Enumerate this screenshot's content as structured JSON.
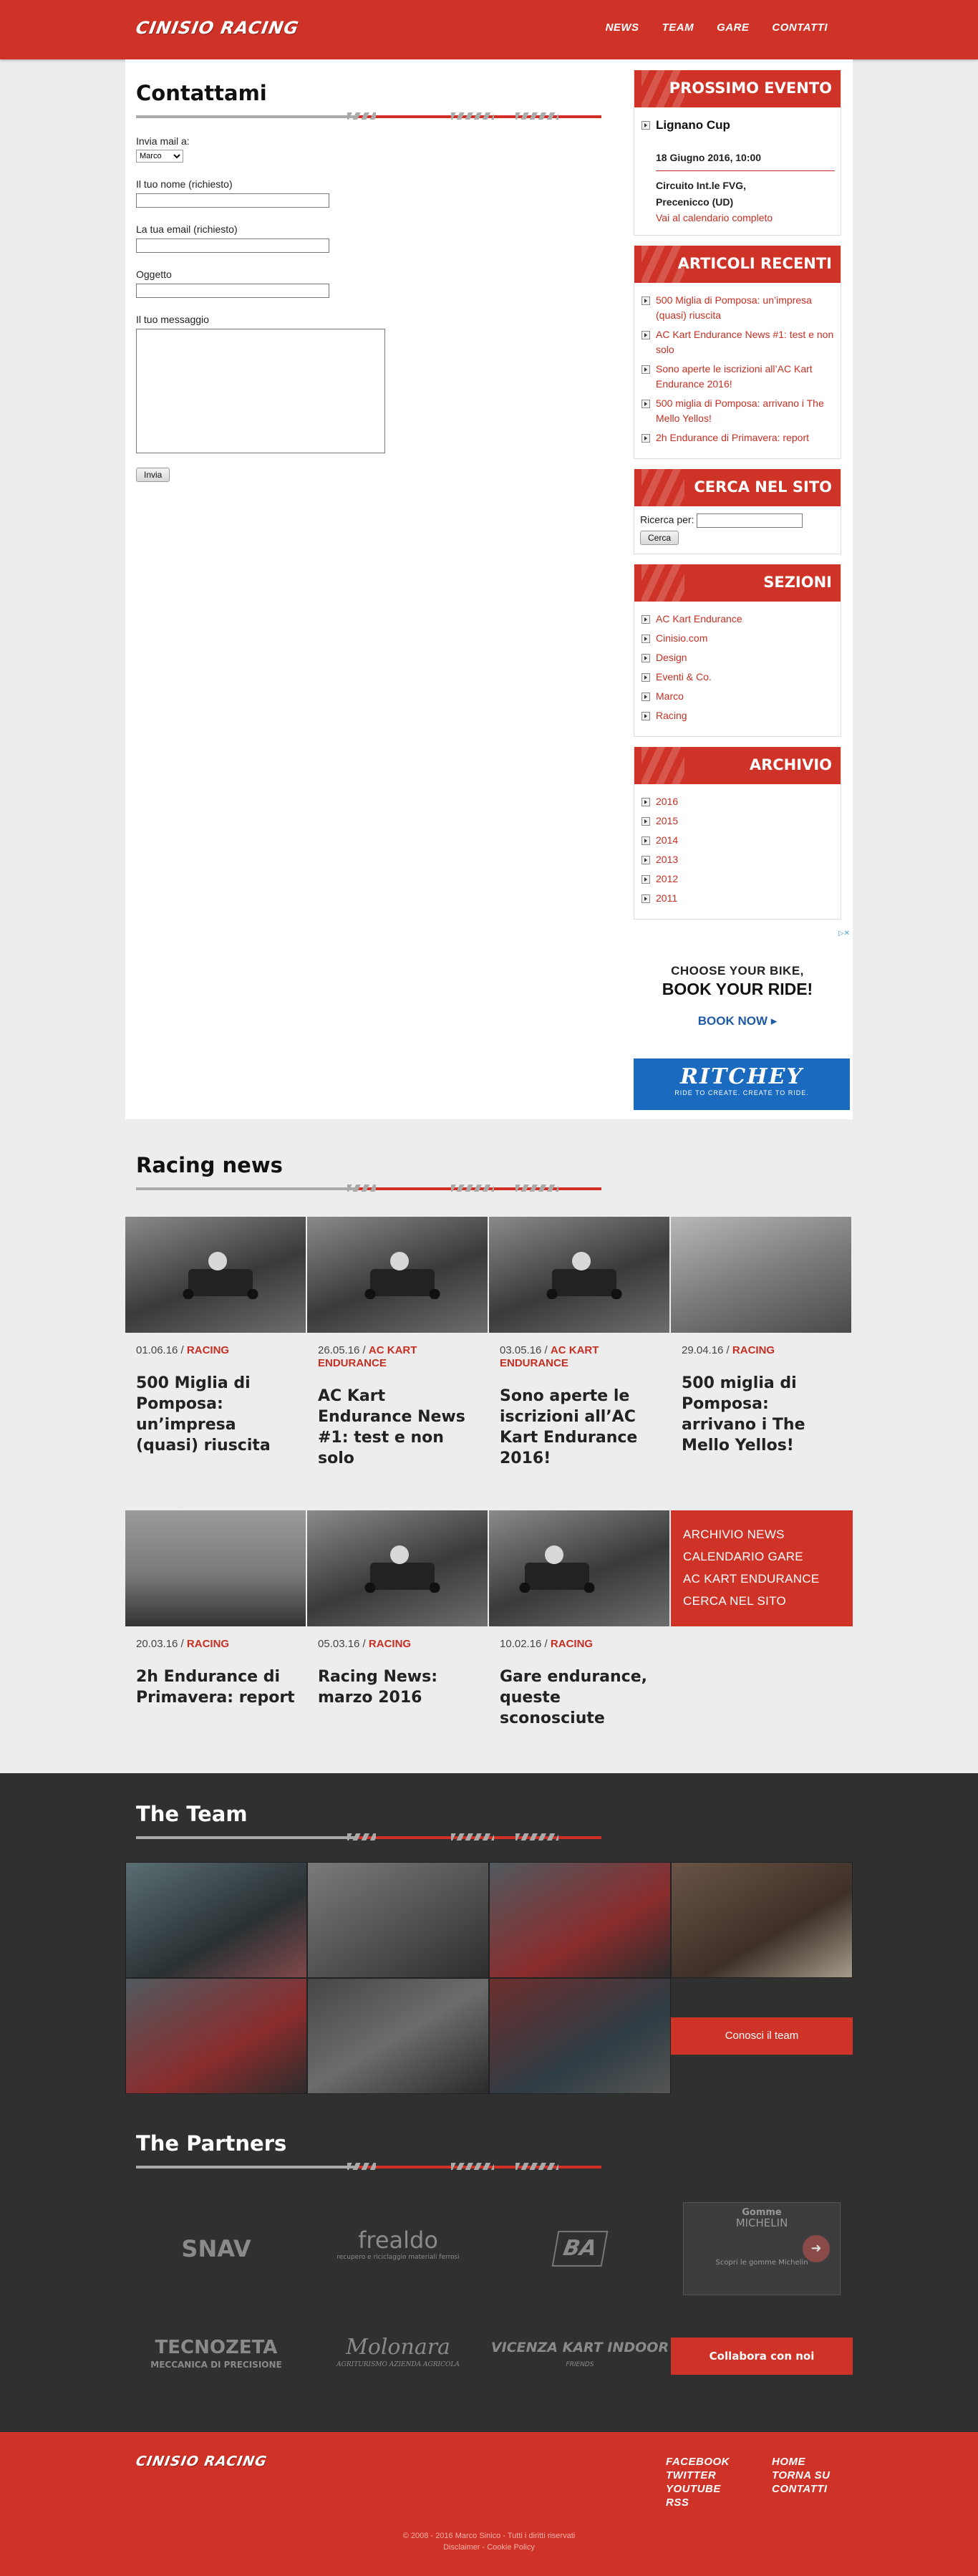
{
  "header": {
    "logo": "CINISIO RACING",
    "nav": [
      "NEWS",
      "TEAM",
      "GARE",
      "CONTATTI"
    ]
  },
  "contact": {
    "title": "Contattami",
    "send_to_label": "Invia mail a:",
    "send_to_value": "Marco",
    "name_label": "Il tuo nome (richiesto)",
    "email_label": "La tua email (richiesto)",
    "subject_label": "Oggetto",
    "message_label": "Il tuo messaggio",
    "submit_label": "Invia"
  },
  "sidebar": {
    "next_event": {
      "title": "PROSSIMO EVENTO",
      "event_name": "Lignano Cup",
      "date": "18 Giugno 2016, 10:00",
      "place_line1": "Circuito Int.le FVG,",
      "place_line2": "Precenicco (UD)",
      "calendar_link": "Vai al calendario completo"
    },
    "recent": {
      "title": "ARTICOLI RECENTI",
      "items": [
        "500 Miglia di Pomposa: un’impresa (quasi) riuscita",
        "AC Kart Endurance News #1: test e non solo",
        "Sono aperte le iscrizioni all’AC Kart Endurance 2016!",
        "500 miglia di Pomposa: arrivano i The Mello Yellos!",
        "2h Endurance di Primavera: report"
      ]
    },
    "search": {
      "title": "CERCA NEL SITO",
      "label": "Ricerca per:",
      "button": "Cerca"
    },
    "sections": {
      "title": "SEZIONI",
      "items": [
        "AC Kart Endurance",
        "Cinisio.com",
        "Design",
        "Eventi & Co.",
        "Marco",
        "Racing"
      ]
    },
    "archive": {
      "title": "ARCHIVIO",
      "items": [
        "2016",
        "2015",
        "2014",
        "2013",
        "2012",
        "2011"
      ]
    },
    "ad": {
      "line1": "CHOOSE YOUR BIKE,",
      "line2": "BOOK YOUR RIDE!",
      "cta": "BOOK NOW ▸",
      "brand": "RITCHEY",
      "tagline": "RIDE TO CREATE. CREATE TO RIDE."
    }
  },
  "news": {
    "title": "Racing news",
    "cards": [
      {
        "date": "01.06.16",
        "category": "RACING",
        "title": "500 Miglia di Pomposa: un’impresa (quasi) riuscita"
      },
      {
        "date": "26.05.16",
        "category": "AC KART ENDURANCE",
        "title": "AC Kart Endurance News #1: test e non solo"
      },
      {
        "date": "03.05.16",
        "category": "AC KART ENDURANCE",
        "title": "Sono aperte le iscrizioni all’AC Kart Endurance 2016!"
      },
      {
        "date": "29.04.16",
        "category": "RACING",
        "title": "500 miglia di Pomposa: arrivano i The Mello Yellos!"
      },
      {
        "date": "20.03.16",
        "category": "RACING",
        "title": "2h Endurance di Primavera: report"
      },
      {
        "date": "05.03.16",
        "category": "RACING",
        "title": "Racing News: marzo 2016"
      },
      {
        "date": "10.02.16",
        "category": "RACING",
        "title": "Gare endurance, queste sconosciute"
      }
    ],
    "links": [
      "ARCHIVIO NEWS",
      "CALENDARIO GARE",
      "AC KART ENDURANCE",
      "CERCA NEL SITO"
    ]
  },
  "team": {
    "title": "The Team",
    "button": "Conosci il team"
  },
  "partners": {
    "title": "The Partners",
    "logos": [
      {
        "name": "SNAV",
        "sub": ""
      },
      {
        "name": "frealdo",
        "sub": "recupero e riciclaggio materiali ferrosi"
      },
      {
        "name": "BA",
        "sub": ""
      },
      {
        "name": "TECNOZETA",
        "sub": "MECCANICA DI PRECISIONE"
      },
      {
        "name": "Molonara",
        "sub": "AGRITURISMO AZIENDA AGRICOLA"
      },
      {
        "name": "VICENZA KART INDOOR",
        "sub": "FRIENDS"
      }
    ],
    "ad": {
      "line1": "Gomme",
      "line2": "MICHELIN",
      "line3": "Scopri le gomme Michelin"
    },
    "button": "Collabora con noi"
  },
  "footer": {
    "logo": "CINISIO RACING",
    "col1": [
      "FACEBOOK",
      "TWITTER",
      "YOUTUBE",
      "RSS"
    ],
    "col2": [
      "HOME",
      "TORNA SU",
      "CONTATTI"
    ],
    "copyright": "© 2008 - 2016 Marco Sinico - Tutti i diritti riservati",
    "legal": "Disclaimer - Cookie Policy"
  }
}
